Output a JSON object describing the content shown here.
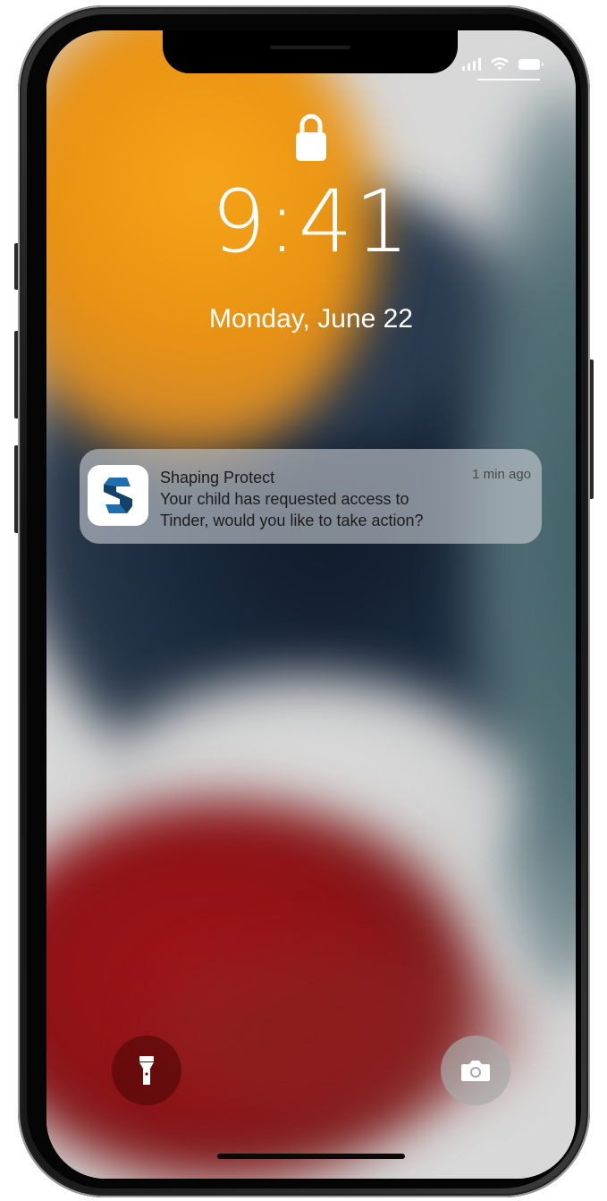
{
  "lock_screen": {
    "time": "9:41",
    "date": "Monday, June 22"
  },
  "status_bar": {
    "icons": [
      "cellular-signal-icon",
      "wifi-icon",
      "battery-icon"
    ]
  },
  "notification": {
    "app_name": "Shaping Protect",
    "timestamp": "1 min ago",
    "message_line1": "Your child has requested access to",
    "message_line2": "Tinder, would you like to take action?",
    "icon": "shaping-protect-s-logo",
    "brand_colors": [
      "#1e6fb0",
      "#123a5e"
    ]
  },
  "quick_actions": {
    "left": "flashlight-icon",
    "right": "camera-icon"
  }
}
